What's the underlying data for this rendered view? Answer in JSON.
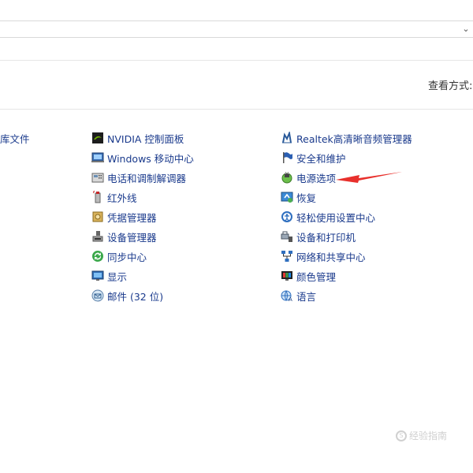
{
  "header": {
    "view_by_label": "查看方式:"
  },
  "left_partial": {
    "label": "库文件"
  },
  "column_middle": [
    {
      "label": "NVIDIA 控制面板",
      "icon": "nvidia-icon"
    },
    {
      "label": "Windows 移动中心",
      "icon": "mobility-center-icon"
    },
    {
      "label": "电话和调制解调器",
      "icon": "phone-modem-icon"
    },
    {
      "label": "红外线",
      "icon": "infrared-icon"
    },
    {
      "label": "凭据管理器",
      "icon": "credential-manager-icon"
    },
    {
      "label": "设备管理器",
      "icon": "device-manager-icon"
    },
    {
      "label": "同步中心",
      "icon": "sync-center-icon"
    },
    {
      "label": "显示",
      "icon": "display-icon"
    },
    {
      "label": "邮件 (32 位)",
      "icon": "mail-icon"
    }
  ],
  "column_right": [
    {
      "label": "Realtek高清晰音频管理器",
      "icon": "realtek-audio-icon"
    },
    {
      "label": "安全和维护",
      "icon": "security-flag-icon"
    },
    {
      "label": "电源选项",
      "icon": "power-options-icon"
    },
    {
      "label": "恢复",
      "icon": "recovery-icon"
    },
    {
      "label": "轻松使用设置中心",
      "icon": "ease-of-access-icon"
    },
    {
      "label": "设备和打印机",
      "icon": "devices-printers-icon"
    },
    {
      "label": "网络和共享中心",
      "icon": "network-sharing-icon"
    },
    {
      "label": "颜色管理",
      "icon": "color-management-icon"
    },
    {
      "label": "语言",
      "icon": "language-icon"
    }
  ],
  "annotation": {
    "arrow_color": "#e8302c"
  },
  "watermark": {
    "text": "经验指南"
  }
}
